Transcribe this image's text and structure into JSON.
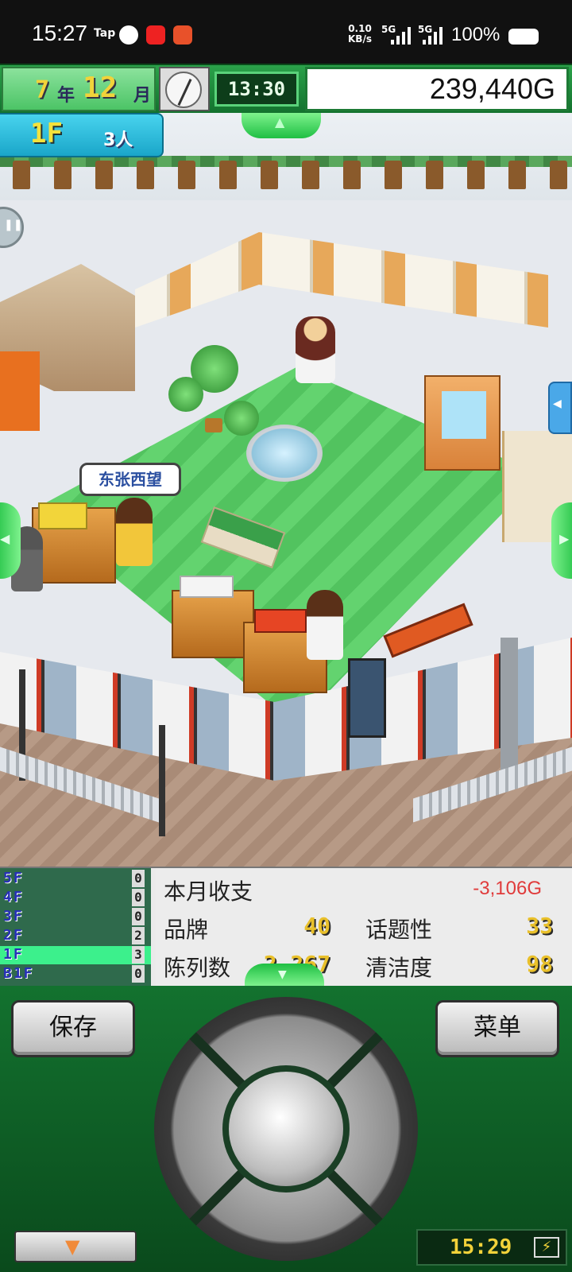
{
  "status_bar": {
    "time": "15:27",
    "tap_label": "Tap",
    "net_speed": "0.10",
    "net_speed_unit": "KB/s",
    "net_1": "5G",
    "net_2": "5G",
    "battery_pct": "100%"
  },
  "hud": {
    "year": "7",
    "year_unit": "年",
    "month": "12",
    "month_unit": "月",
    "game_time": "13:30",
    "money": "239,440G"
  },
  "floor_badge": {
    "floor": "1F",
    "people": "3人"
  },
  "speech_bubble": "东张西望",
  "floors_list": [
    {
      "label": "5F",
      "count": "0"
    },
    {
      "label": "4F",
      "count": "0"
    },
    {
      "label": "3F",
      "count": "0"
    },
    {
      "label": "2F",
      "count": "2"
    },
    {
      "label": "1F",
      "count": "3"
    },
    {
      "label": "B1F",
      "count": "0"
    }
  ],
  "stats": {
    "monthly_label": "本月收支",
    "monthly_value": "-3,106G",
    "brand_label": "品牌",
    "brand_value": "40",
    "topic_label": "话题性",
    "topic_value": "33",
    "display_label": "陈列数",
    "display_value": "2,267",
    "clean_label": "清洁度",
    "clean_value": "98"
  },
  "controls": {
    "save_label": "保存",
    "menu_label": "菜单",
    "clock": "15:29"
  },
  "icons": [
    "message-icon",
    "app-badge-icon",
    "taobao-icon",
    "signal-icon",
    "battery-icon",
    "clock-icon",
    "pause-icon",
    "arrow-up-icon",
    "arrow-left-icon",
    "arrow-right-icon",
    "arrow-down-icon",
    "lightning-icon"
  ]
}
